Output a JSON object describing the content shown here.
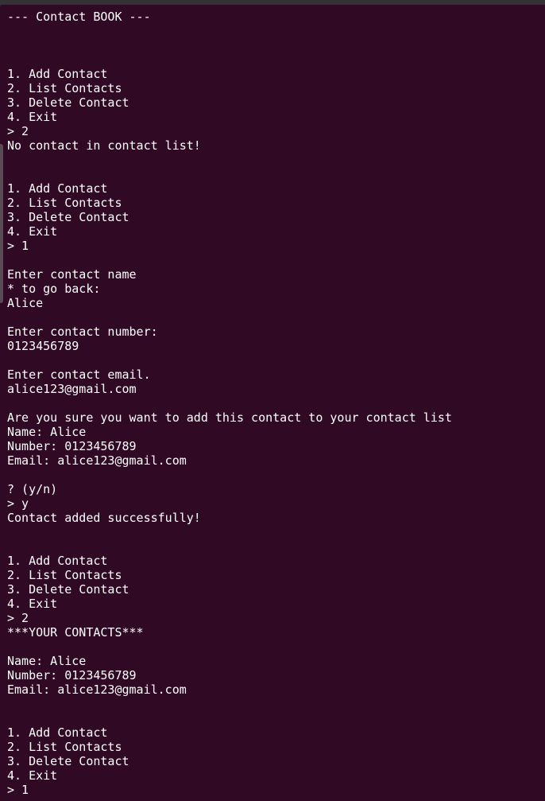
{
  "terminal": {
    "lines": [
      "--- Contact BOOK ---",
      "",
      "",
      "",
      "1. Add Contact",
      "2. List Contacts",
      "3. Delete Contact",
      "4. Exit",
      "> 2",
      "No contact in contact list!",
      "",
      "",
      "1. Add Contact",
      "2. List Contacts",
      "3. Delete Contact",
      "4. Exit",
      "> 1",
      "",
      "Enter contact name",
      "* to go back:",
      "Alice",
      "",
      "Enter contact number:",
      "0123456789",
      "",
      "Enter contact email.",
      "alice123@gmail.com",
      "",
      "Are you sure you want to add this contact to your contact list",
      "Name: Alice",
      "Number: 0123456789",
      "Email: alice123@gmail.com",
      "",
      "? (y/n)",
      "> y",
      "Contact added successfully!",
      "",
      "",
      "1. Add Contact",
      "2. List Contacts",
      "3. Delete Contact",
      "4. Exit",
      "> 2",
      "***YOUR CONTACTS***",
      "",
      "Name: Alice",
      "Number: 0123456789",
      "Email: alice123@gmail.com",
      "",
      "",
      "1. Add Contact",
      "2. List Contacts",
      "3. Delete Contact",
      "4. Exit",
      "> 1"
    ]
  },
  "colors": {
    "background": "#300a24",
    "text": "#ffffff"
  }
}
